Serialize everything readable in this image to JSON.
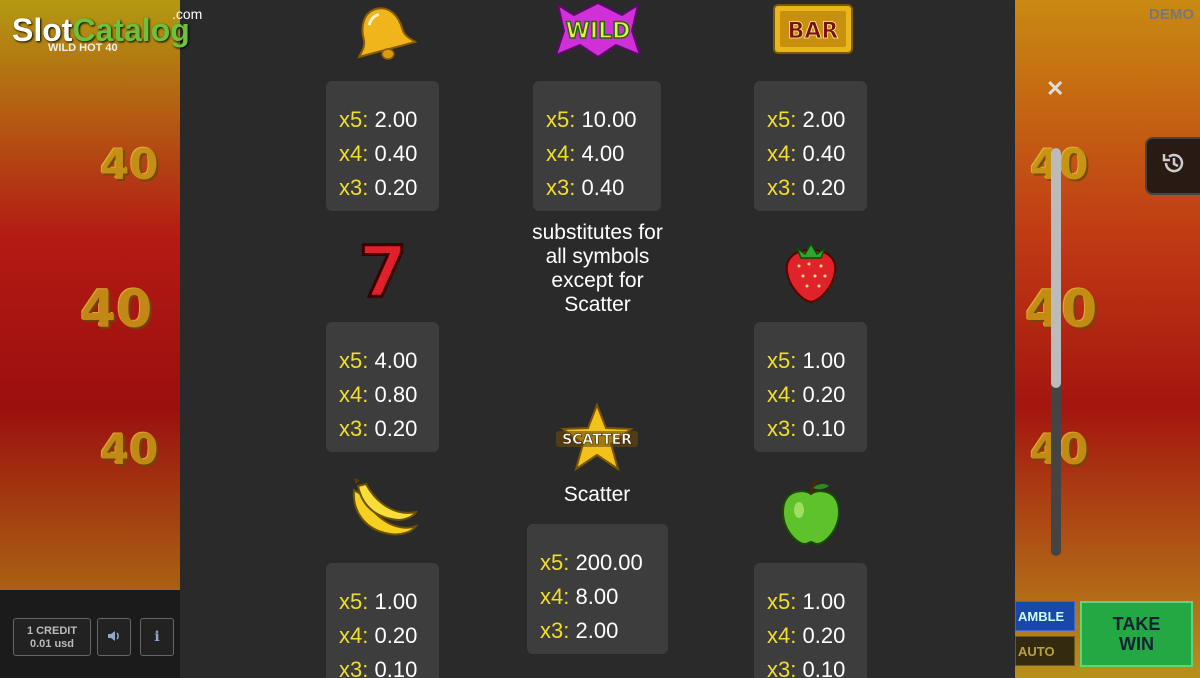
{
  "branding": {
    "watermark_slot": "Slot",
    "watermark_catalog": "Catalog",
    "watermark_com": ".com",
    "game_name": "WILD HOT 40",
    "demo_label": "DEMO"
  },
  "background_values": [
    "40",
    "40",
    "40",
    "40",
    "40",
    "40"
  ],
  "controls": {
    "credit_line1": "1 CREDIT",
    "credit_line2": "0.01 usd",
    "gamble": "AMBLE",
    "auto": "AUTO",
    "take_win_line1": "TAKE",
    "take_win_line2": "WIN"
  },
  "paytable": {
    "bell": {
      "icon": "bell-icon",
      "x5": "2.00",
      "x4": "0.40",
      "x3": "0.20"
    },
    "wild": {
      "icon": "wild-icon",
      "label": "WILD",
      "x5": "10.00",
      "x4": "4.00",
      "x3": "0.40",
      "description": "substitutes for all symbols except for Scatter"
    },
    "bar": {
      "icon": "bar-icon",
      "label": "BAR",
      "x5": "2.00",
      "x4": "0.40",
      "x3": "0.20"
    },
    "seven": {
      "icon": "seven-icon",
      "label": "7",
      "x5": "4.00",
      "x4": "0.80",
      "x3": "0.20"
    },
    "strawberry": {
      "icon": "strawberry-icon",
      "x5": "1.00",
      "x4": "0.20",
      "x3": "0.10"
    },
    "scatter": {
      "icon": "scatter-icon",
      "badge": "SCATTER",
      "label": "Scatter",
      "x5": "200.00",
      "x4": "8.00",
      "x3": "2.00"
    },
    "banana": {
      "icon": "banana-icon",
      "x5": "1.00",
      "x4": "0.20",
      "x3": "0.10"
    },
    "apple": {
      "icon": "apple-icon",
      "x5": "1.00",
      "x4": "0.20",
      "x3": "0.10"
    },
    "multiplier_labels": {
      "x5": "x5:",
      "x4": "x4:",
      "x3": "x3:"
    }
  },
  "colors": {
    "panel_bg": "#2a2a2a",
    "box_bg": "#3d3d3d",
    "multiplier_key": "#f2de2a",
    "value": "#ffffff"
  }
}
